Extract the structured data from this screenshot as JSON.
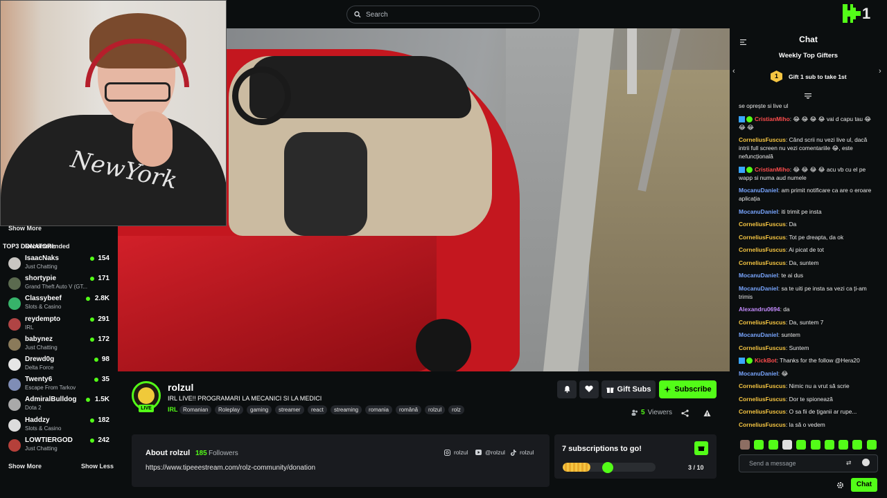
{
  "search": {
    "placeholder": "Search"
  },
  "logo": {
    "text": "1"
  },
  "sidebar": {
    "show_more_top": "Show More",
    "heading": "Recommended",
    "overlay": "TOP3 DONATORI:",
    "items": [
      {
        "name": "IsaacNaks",
        "category": "Just Chatting",
        "count": "154",
        "color": "#c9c6c2"
      },
      {
        "name": "shortypie",
        "category": "Grand Theft Auto V (GT...",
        "count": "171",
        "color": "#5b6a4f"
      },
      {
        "name": "Classybeef",
        "category": "Slots & Casino",
        "count": "2.8K",
        "color": "#37b36a"
      },
      {
        "name": "reydempto",
        "category": "IRL",
        "count": "291",
        "color": "#b04444"
      },
      {
        "name": "babynez",
        "category": "Just Chatting",
        "count": "172",
        "color": "#8a7a5a"
      },
      {
        "name": "Drewd0g",
        "category": "Delta Force",
        "count": "98",
        "color": "#e6e6e6"
      },
      {
        "name": "Twenty6",
        "category": "Escape From Tarkov",
        "count": "35",
        "color": "#7f8db6"
      },
      {
        "name": "AdmiralBulldog",
        "category": "Dota 2",
        "count": "1.5K",
        "color": "#a9a9a9"
      },
      {
        "name": "Haddzy",
        "category": "Slots & Casino",
        "count": "182",
        "color": "#dcdcdc"
      },
      {
        "name": "LOWTIERGOD",
        "category": "Just Chatting",
        "count": "242",
        "color": "#b5403a"
      }
    ],
    "show_more_bottom": "Show More",
    "show_less": "Show Less"
  },
  "channel": {
    "name": "rolzul",
    "live_label": "LIVE",
    "title": "IRL LIVE!! PROGRAMARI LA MECANICI SI LA MEDICI",
    "category": "IRL",
    "tags": [
      "Romanian",
      "Roleplay",
      "gaming",
      "streamer",
      "react",
      "streaming",
      "romania",
      "română",
      "rolzul",
      "rolz"
    ],
    "gift_subs_label": "Gift Subs",
    "subscribe_label": "Subscribe",
    "viewers_count": "5",
    "viewers_label": "Viewers"
  },
  "about": {
    "title": "About rolzul",
    "followers_count": "185",
    "followers_label": "Followers",
    "link": "https://www.tipeeestream.com/rolz-community/donation",
    "socials": [
      "rolzul",
      "@rolzul",
      "rolzul"
    ]
  },
  "sub_goal": {
    "title": "7 subscriptions to go!",
    "progress_text": "3 / 10",
    "progress_fraction": 0.3
  },
  "chat": {
    "title": "Chat",
    "gifters_title": "Weekly Top Gifters",
    "gifters_rank": "1",
    "gifters_cta": "Gift 1 sub to take 1st",
    "messages": [
      {
        "user": "",
        "text": "se oprește si live ul",
        "color": "#e9e9e9"
      },
      {
        "user": "CristianMiho",
        "text": "😂 😂 😂 😂 vai d capu tau 😂 😂 😂",
        "color": "#ff4d4d"
      },
      {
        "user": "CorneliusFuscus",
        "text": "Când scrii nu vezi live ul, dacă intrii full screen nu vezi comentariile 😂, este nefuncțională",
        "color": "#f5c542"
      },
      {
        "user": "CristianMiho",
        "text": "😂 😂 😂 😂 acu vb cu el pe wapp si numa aud numele",
        "color": "#ff4d4d"
      },
      {
        "user": "MocanuDaniel",
        "text": "am primit notificare ca are o eroare aplicația",
        "color": "#79a6ff"
      },
      {
        "user": "MocanuDaniel",
        "text": "iti trimit pe insta",
        "color": "#79a6ff"
      },
      {
        "user": "CorneliusFuscus",
        "text": "Da",
        "color": "#f5c542"
      },
      {
        "user": "CorneliusFuscus",
        "text": "Tot pe dreapta, da ok",
        "color": "#f5c542"
      },
      {
        "user": "CorneliusFuscus",
        "text": "Ai picat de tot",
        "color": "#f5c542"
      },
      {
        "user": "CorneliusFuscus",
        "text": "Da, suntem",
        "color": "#f5c542"
      },
      {
        "user": "MocanuDaniel",
        "text": "te ai dus",
        "color": "#79a6ff"
      },
      {
        "user": "MocanuDaniel",
        "text": "sa te uiti pe insta sa vezi ca ți-am trimis",
        "color": "#79a6ff"
      },
      {
        "user": "Alexandru0694",
        "text": "da",
        "color": "#c58cff"
      },
      {
        "user": "CorneliusFuscus",
        "text": "Da, suntem 7",
        "color": "#f5c542"
      },
      {
        "user": "MocanuDaniel",
        "text": "suntem",
        "color": "#79a6ff"
      },
      {
        "user": "CorneliusFuscus",
        "text": "Suntem",
        "color": "#f5c542"
      },
      {
        "user": "KickBot",
        "text": "Thanks for the follow @Hera20",
        "color": "#ff4d4d"
      },
      {
        "user": "MocanuDaniel",
        "text": "😂",
        "color": "#79a6ff"
      },
      {
        "user": "CorneliusFuscus",
        "text": "Nimic nu a vrut să scrie",
        "color": "#f5c542"
      },
      {
        "user": "CorneliusFuscus",
        "text": "Dor te spionează",
        "color": "#f5c542"
      },
      {
        "user": "CorneliusFuscus",
        "text": "O sa fii de țiganii ar rupe...",
        "color": "#f5c542"
      },
      {
        "user": "CorneliusFuscus",
        "text": "la să o vedem",
        "color": "#f5c542"
      }
    ],
    "input_placeholder": "Send a message",
    "send_label": "Chat"
  },
  "webcam": {
    "shirt_text": "NewYork"
  },
  "colors": {
    "accent": "#53fc18",
    "bg": "#0b0e0f",
    "panel": "#191b1f"
  }
}
